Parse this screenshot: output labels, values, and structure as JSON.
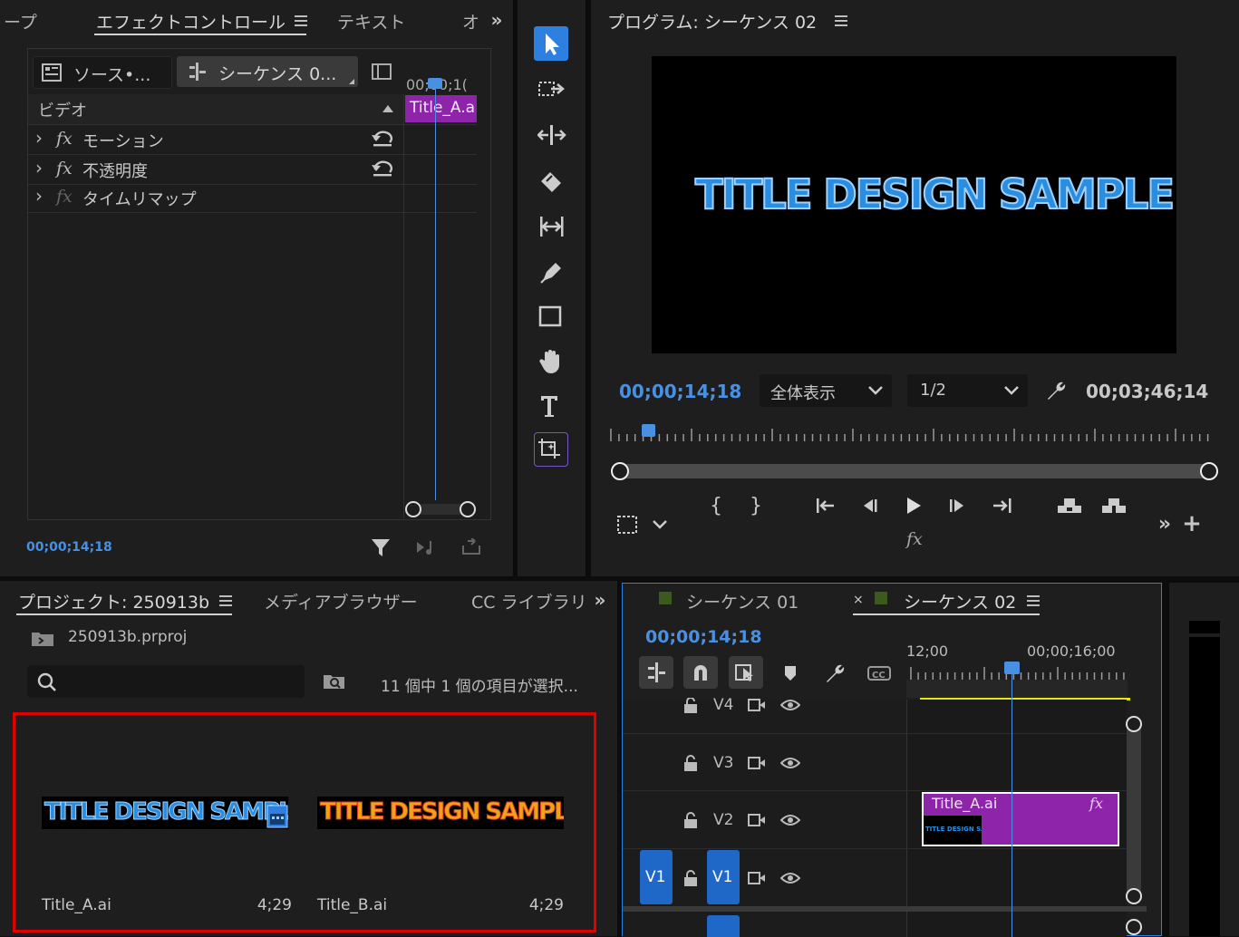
{
  "effect_controls": {
    "tab_prev_partial": "ープ",
    "tab_active": "エフェクトコントロール",
    "tab_text": "テキスト",
    "tab_next_partial": "オ",
    "source_button": "ソース•...",
    "sequence_button": "シーケンス 0...",
    "mini_timecode": "00;00;1(",
    "clip_label": "Title_A.a",
    "section_video": "ビデオ",
    "effects": [
      {
        "label": "モーション"
      },
      {
        "label": "不透明度"
      },
      {
        "label": "タイムリマップ"
      }
    ],
    "timecode": "00;00;14;18"
  },
  "program_monitor": {
    "title": "プログラム: シーケンス 02",
    "preview_text": "TITLE DESIGN SAMPLE",
    "current_time": "00;00;14;18",
    "zoom_select": "全体表示",
    "resolution_select": "1/2",
    "duration": "00;03;46;14",
    "fx_label": "fx"
  },
  "project": {
    "tab_project": "プロジェクト: 250913b",
    "tab_media": "メディアブラウザー",
    "tab_cc": "CC ライブラリ",
    "file_name": "250913b.prproj",
    "selection_status": "11 個中 1 個の項目が選択...",
    "search_placeholder": "",
    "items": [
      {
        "name": "Title_A.ai",
        "duration": "4;29",
        "thumb_text": "TITLE DESIGN SAMPL"
      },
      {
        "name": "Title_B.ai",
        "duration": "4;29",
        "thumb_text": "TITLE DESIGN SAMPLE"
      }
    ]
  },
  "timeline": {
    "tab1": "シーケンス 01",
    "tab2": "シーケンス 02",
    "close_mark": "×",
    "timecode": "00;00;14;18",
    "ruler_labels": [
      "12;00",
      "00;00;16;00"
    ],
    "tracks": [
      {
        "name": "V4"
      },
      {
        "name": "V3"
      },
      {
        "name": "V2"
      },
      {
        "name": "V1"
      }
    ],
    "source_patch": "V1",
    "clip_name": "Title_A.ai",
    "clip_fx": "fx",
    "clip_thumb_text": "TITLE DESIGN SAMPLE"
  },
  "colors": {
    "accent_blue": "#2d7fe0",
    "timecode_blue": "#4a90e2",
    "clip_purple": "#8e24aa",
    "selection_red": "#e10000",
    "work_area_yellow": "#e6e600",
    "title_blue": "#2a8de0",
    "title_orange": "#f2a21a"
  }
}
